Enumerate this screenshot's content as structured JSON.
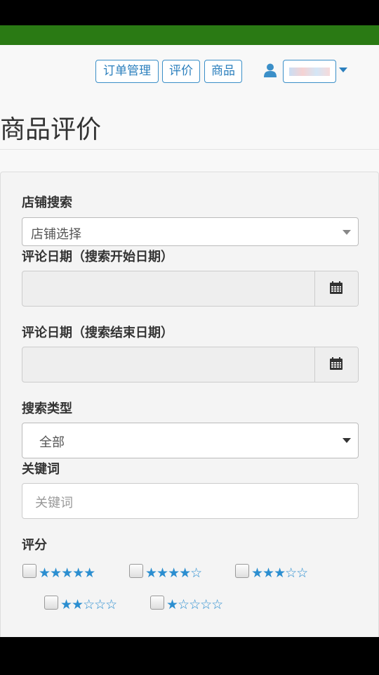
{
  "nav": {
    "orders_label": "订单管理",
    "reviews_label": "评价",
    "products_label": "商品"
  },
  "page": {
    "title": "商品评价"
  },
  "form": {
    "store": {
      "label": "店铺搜索",
      "selected": "店铺选择"
    },
    "start_date": {
      "label": "评论日期（搜索开始日期）",
      "value": ""
    },
    "end_date": {
      "label": "评论日期（搜索结束日期）",
      "value": ""
    },
    "search_type": {
      "label": "搜索类型",
      "selected": "全部"
    },
    "keyword": {
      "label": "关键词",
      "placeholder": "关键词",
      "value": ""
    },
    "rating": {
      "label": "评分",
      "options": [
        {
          "stars": "★★★★★",
          "checked": false
        },
        {
          "stars": "★★★★☆",
          "checked": false
        },
        {
          "stars": "★★★☆☆",
          "checked": false
        },
        {
          "stars": "★★☆☆☆",
          "checked": false
        },
        {
          "stars": "★☆☆☆☆",
          "checked": false
        }
      ]
    }
  },
  "colors": {
    "brand_green": "#2a7a14",
    "accent_blue": "#2b8ed0"
  },
  "icons": {
    "user": "user-icon",
    "calendar": "calendar-icon"
  }
}
